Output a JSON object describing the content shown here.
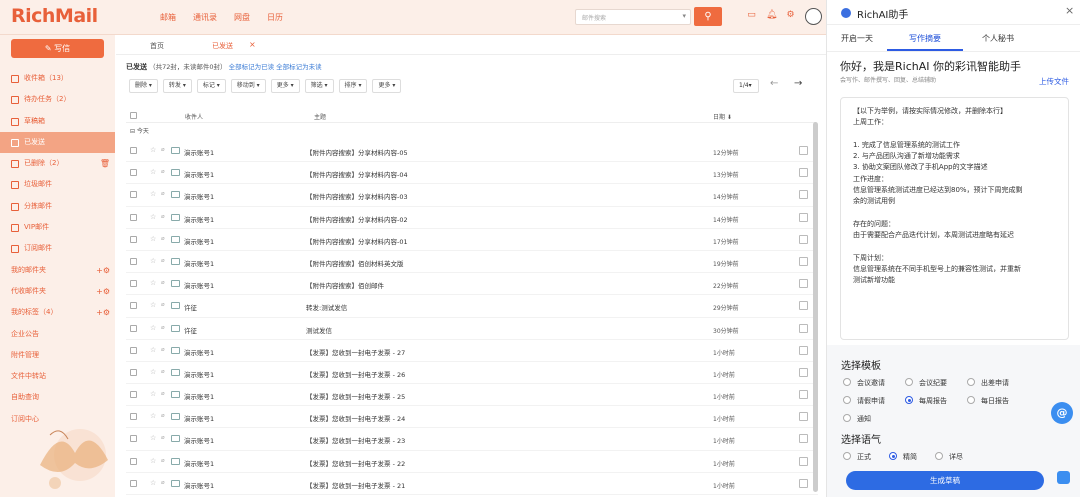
{
  "app": {
    "logo": "RichMail"
  },
  "topnav": [
    "邮箱",
    "通讯录",
    "网盘",
    "日历"
  ],
  "search": {
    "placeholder": "邮件搜索"
  },
  "sidebar": {
    "write_label": "写信",
    "items": [
      {
        "label": "收件箱（13）",
        "kind": "icon"
      },
      {
        "label": "待办任务（2）",
        "kind": "icon"
      },
      {
        "label": "草稿箱",
        "kind": "icon"
      },
      {
        "label": "已发送",
        "kind": "icon",
        "active": true
      },
      {
        "label": "已删除（2）",
        "kind": "icon",
        "action": "trash"
      },
      {
        "label": "垃圾邮件",
        "kind": "icon"
      },
      {
        "label": "分拣邮件",
        "kind": "icon"
      },
      {
        "label": "VIP邮件",
        "kind": "icon"
      },
      {
        "label": "订阅邮件",
        "kind": "icon"
      },
      {
        "label": "我的邮件夹",
        "kind": "plain",
        "action": "add"
      },
      {
        "label": "代收邮件夹",
        "kind": "plain",
        "action": "add"
      },
      {
        "label": "我的标签（4）",
        "kind": "plain",
        "action": "add"
      },
      {
        "label": "企业公告",
        "kind": "plain"
      },
      {
        "label": "附件管理",
        "kind": "plain"
      },
      {
        "label": "文件中转站",
        "kind": "plain"
      },
      {
        "label": "自助查询",
        "kind": "plain"
      },
      {
        "label": "订阅中心",
        "kind": "plain"
      }
    ]
  },
  "tabs": {
    "home": "首页",
    "sent": "已发送"
  },
  "subhead": {
    "title": "已发送",
    "count": "（共72封，未读邮件0封）",
    "link1": "全部标记为已读",
    "link2": "全部标记为未读"
  },
  "toolbar": [
    "删除 ▾",
    "转发 ▾",
    "标记 ▾",
    "移动到 ▾",
    "更多 ▾",
    "筛选 ▾",
    "排序 ▾",
    "更多 ▾"
  ],
  "pager": {
    "page": "1/4▾"
  },
  "table": {
    "col_recipient": "收件人",
    "col_subject": "主题",
    "col_date": "日期 ⬇",
    "group": "⊟ 今天"
  },
  "rows": [
    {
      "sender": "演示账号1",
      "subject": "【附件内容搜索】分享材料内容-05",
      "time": "12分钟前"
    },
    {
      "sender": "演示账号1",
      "subject": "【附件内容搜索】分享材料内容-04",
      "time": "13分钟前"
    },
    {
      "sender": "演示账号1",
      "subject": "【附件内容搜索】分享材料内容-03",
      "time": "14分钟前"
    },
    {
      "sender": "演示账号1",
      "subject": "【附件内容搜索】分享材料内容-02",
      "time": "14分钟前"
    },
    {
      "sender": "演示账号1",
      "subject": "【附件内容搜索】分享材料内容-01",
      "time": "17分钟前"
    },
    {
      "sender": "演示账号1",
      "subject": "【附件内容搜索】佰创材料英文版",
      "time": "19分钟前"
    },
    {
      "sender": "演示账号1",
      "subject": "【附件内容搜索】佰创邮件",
      "time": "22分钟前"
    },
    {
      "sender": "许征",
      "subject": "转发:测试发信",
      "time": "29分钟前"
    },
    {
      "sender": "许征",
      "subject": "测试发信",
      "time": "30分钟前"
    },
    {
      "sender": "演示账号1",
      "subject": "【发票】您收到一封电子发票 - 27",
      "time": "1小时前"
    },
    {
      "sender": "演示账号1",
      "subject": "【发票】您收到一封电子发票 - 26",
      "time": "1小时前"
    },
    {
      "sender": "演示账号1",
      "subject": "【发票】您收到一封电子发票 - 25",
      "time": "1小时前"
    },
    {
      "sender": "演示账号1",
      "subject": "【发票】您收到一封电子发票 - 24",
      "time": "1小时前"
    },
    {
      "sender": "演示账号1",
      "subject": "【发票】您收到一封电子发票 - 23",
      "time": "1小时前"
    },
    {
      "sender": "演示账号1",
      "subject": "【发票】您收到一封电子发票 - 22",
      "time": "1小时前"
    },
    {
      "sender": "演示账号1",
      "subject": "【发票】您收到一封电子发票 - 21",
      "time": "1小时前"
    }
  ],
  "panel": {
    "title": "RichAI助手",
    "tabs": [
      "开启一天",
      "写作摘要",
      "个人秘书"
    ],
    "greeting": "你好，我是RichAI 你的彩讯智能助手",
    "greeting_sub": "会写作、邮件撰写、回复、总结辅助",
    "upload": "上传文件",
    "lines": [
      "【以下为举例，请按实际情况修改，并删除本行】",
      "上周工作：",
      "",
      "1. 完成了信息管理系统的测试工作",
      "2. 与产品团队沟通了新增功能需求",
      "3. 协助文案团队修改了手机App的文字描述",
      "工作进度：",
      "信息管理系统测试进度已经达到80%，预计下周完成剩",
      "余的测试用例",
      "",
      "存在的问题：",
      "由于需要配合产品迭代计划，本周测试进度略有延迟",
      "",
      "下周计划：",
      "信息管理系统在不同手机型号上的兼容性测试，并重新",
      "测试新增功能"
    ],
    "template_title": "选择模板",
    "templates": [
      "会议邀请",
      "会议纪要",
      "出差申请",
      "请假申请",
      "每周报告",
      "每日报告",
      "通知"
    ],
    "selected_template": "每周报告",
    "tone_title": "选择语气",
    "tones": [
      "正式",
      "精简",
      "详尽"
    ],
    "selected_tone": "精简",
    "generate": "生成草稿"
  },
  "colors": {
    "brand": "#e8603a",
    "accent": "#2d5be3",
    "sidebar_bg": "#fcefe8"
  }
}
